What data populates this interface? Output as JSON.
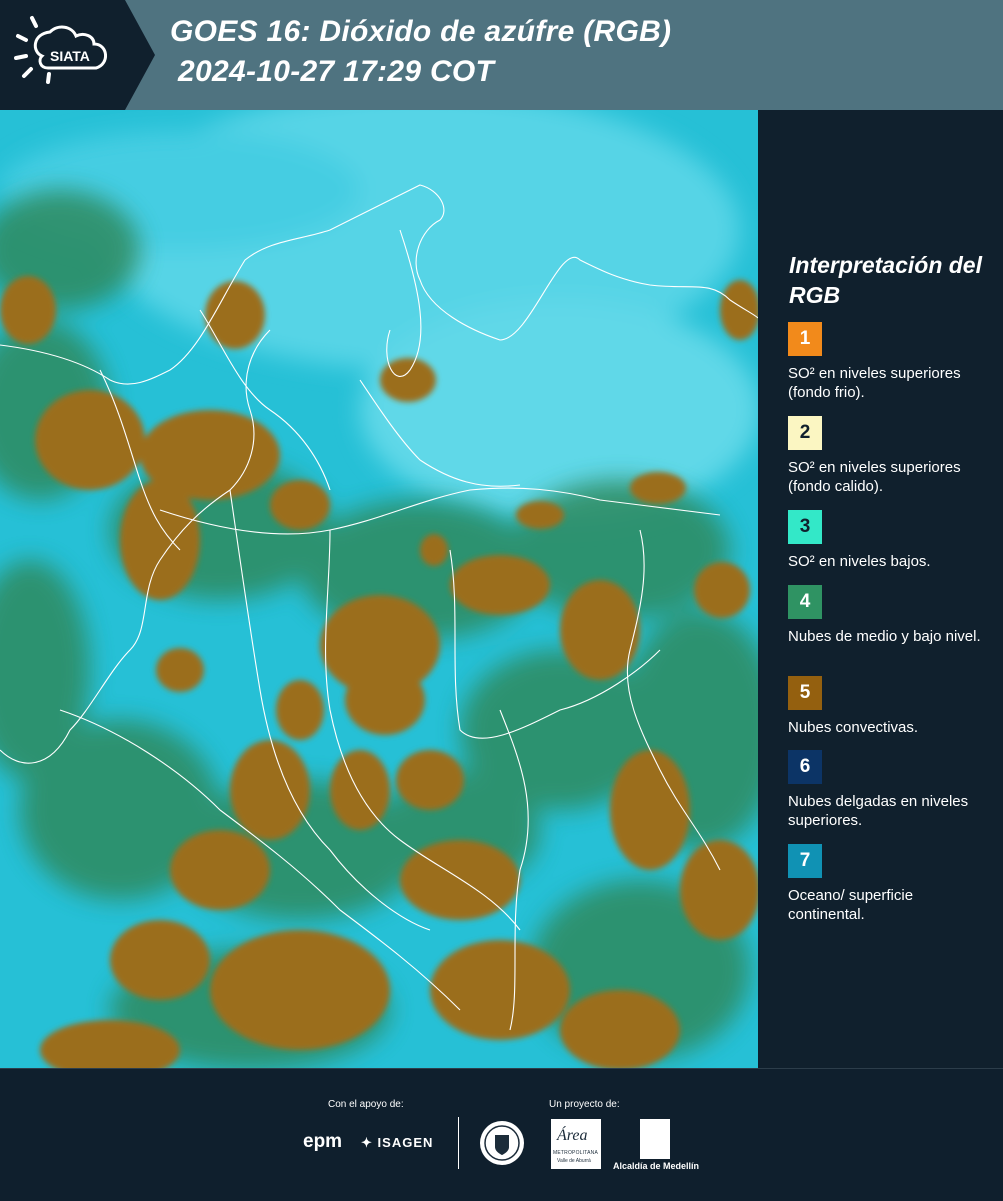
{
  "header": {
    "brand": "SIATA",
    "title": "GOES 16: Dióxido de azúfre (RGB)",
    "timestamp": "2024-10-27 17:29 COT"
  },
  "colors": {
    "band": "#4f7380",
    "dark": "#10202d",
    "map_background": "#1fb7d0",
    "cloud_brown": "#9b6e1e",
    "cloud_green": "#2f8a5e"
  },
  "legend": {
    "title": "Interpretación del RGB",
    "items": [
      {
        "number": "1",
        "color": "#f28a1b",
        "text": "SO² en niveles superiores (fondo frio)."
      },
      {
        "number": "2",
        "color": "#fbf6c2",
        "text": "SO² en niveles superiores (fondo calido)."
      },
      {
        "number": "3",
        "color": "#33e8c8",
        "text": "SO² en niveles bajos."
      },
      {
        "number": "4",
        "color": "#2f9363",
        "text": "Nubes de medio y bajo nivel."
      },
      {
        "number": "5",
        "color": "#94600f",
        "text": "Nubes convectivas."
      },
      {
        "number": "6",
        "color": "#0c3466",
        "text": "Nubes delgadas en niveles superiores."
      },
      {
        "number": "7",
        "color": "#1092b4",
        "text": "Oceano/ superficie continental."
      }
    ]
  },
  "footer": {
    "support_label": "Con el apoyo de:",
    "project_label": "Un proyecto de:",
    "sponsors": [
      "epm",
      "ISAGEN"
    ],
    "partners": [
      "Área Metropolitana Valle de Aburrá",
      "Alcaldía de Medellín"
    ],
    "area_name": "Área",
    "area_sub": "METROPOLITANA",
    "area_sub2": "Valle de Aburrá",
    "alcaldia": "Alcaldía de Medellín"
  }
}
